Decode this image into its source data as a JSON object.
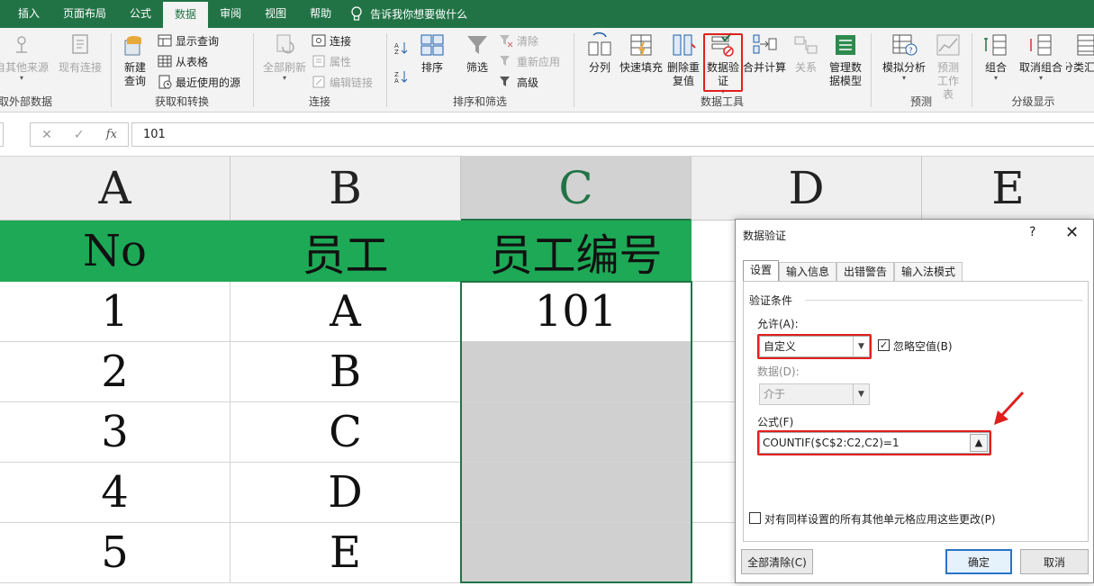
{
  "tabs": [
    "插入",
    "页面布局",
    "公式",
    "数据",
    "审阅",
    "视图",
    "帮助"
  ],
  "active_tab": "数据",
  "tell_me": "告诉我你想要做什么",
  "ribbon": {
    "get_external": {
      "buttons": [
        "自其他来源",
        "现有连接"
      ],
      "label": "获取外部数据"
    },
    "get_transform": {
      "big": [
        "新建",
        "查询"
      ],
      "small": [
        "显示查询",
        "从表格",
        "最近使用的源"
      ],
      "label": "获取和转换"
    },
    "connections": {
      "big": "全部刷新",
      "small": [
        "连接",
        "属性",
        "编辑链接"
      ],
      "label": "连接"
    },
    "sort_filter": {
      "sort": "排序",
      "filter": "筛选",
      "small": [
        "清除",
        "重新应用",
        "高级"
      ],
      "label": "排序和筛选"
    },
    "data_tools": {
      "buttons": [
        "分列",
        "快速填充",
        "删除重复值",
        "数据验证",
        "合并计算",
        "关系",
        "管理数据模型"
      ],
      "label": "数据工具"
    },
    "forecast": {
      "buttons": [
        "模拟分析",
        "预测工作表"
      ],
      "label": "预测"
    },
    "outline": {
      "buttons": [
        "组合",
        "取消组合",
        "分类汇总"
      ],
      "label": "分级显示"
    }
  },
  "formula_bar": {
    "value": "101",
    "fx": "fx"
  },
  "columns": [
    "A",
    "B",
    "C",
    "D",
    "E"
  ],
  "table": {
    "headers": [
      "No",
      "员工",
      "员工编号"
    ],
    "rows": [
      [
        "1",
        "A",
        "101"
      ],
      [
        "2",
        "B",
        ""
      ],
      [
        "3",
        "C",
        ""
      ],
      [
        "4",
        "D",
        ""
      ],
      [
        "5",
        "E",
        ""
      ]
    ]
  },
  "dialog": {
    "title": "数据验证",
    "help": "?",
    "close": "✕",
    "tabs": [
      "设置",
      "输入信息",
      "出错警告",
      "输入法模式"
    ],
    "section": "验证条件",
    "allow_label": "允许(A):",
    "allow_value": "自定义",
    "ignore_blank": "忽略空值(B)",
    "data_label": "数据(D):",
    "data_value": "介于",
    "formula_label": "公式(F)",
    "formula_value": "COUNTIF($C$2:C2,C2)=1",
    "apply_all": "对有同样设置的所有其他单元格应用这些更改(P)",
    "clear_all": "全部清除(C)",
    "ok": "确定",
    "cancel": "取消"
  },
  "colors": {
    "accent": "#217346",
    "header_fill": "#1ea956",
    "highlight": "#e0201d"
  }
}
